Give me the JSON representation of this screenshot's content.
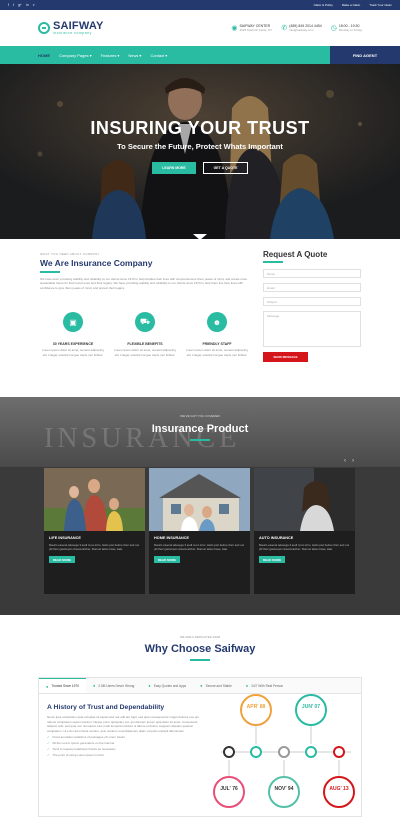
{
  "topbar": {
    "social": [
      "f",
      "t",
      "g+",
      "in",
      "v"
    ],
    "links": [
      "Claim & Policy",
      "Make a Claim",
      "Track Your Claim"
    ]
  },
  "header": {
    "logo_title": "SAIFWAY",
    "logo_subtitle": "insurance company",
    "contacts": [
      {
        "line1": "SAIFWAY CENTER",
        "line2": "1625 Kashmir Circle, NY"
      },
      {
        "line1": "(489) 849 2014 4454",
        "line2": "info@saifway.com"
      },
      {
        "line1": "18:00 - 19:30",
        "line2": "Monday to Friday"
      }
    ]
  },
  "nav": {
    "items": [
      "HOME",
      "Company Pages",
      "Features",
      "News",
      "Contact"
    ],
    "find_agent": "FIND AGENT"
  },
  "hero": {
    "title": "INSURING YOUR TRUST",
    "subtitle": "To Secure the Future, Protect Whats Important",
    "btn_primary": "LEARN MORE",
    "btn_secondary": "GET A QUOTE"
  },
  "about": {
    "subtitle": "WHAT YOU NEED ABOUT COMPANY",
    "title": "We Are Insurance Company",
    "text": "We have been providing stability and reliability to our clients since 1970 to help families their lives with comprehensive them peace of mind, and create more sustainable future for their loved ones and their legacy. We have providing stability and reliability to our clients since 1970 to help them live their lives with confidence to give them peace of mind, and protect their legacy.",
    "features": [
      {
        "title": "30 YEARS EXPERIENCE",
        "text": "Lorem ipsum dolor sit amet, senetul adipiscing elit. Integer suscipit congue turpis nec finibus."
      },
      {
        "title": "FLEXIBLE BENEFITS",
        "text": "Lorem ipsum dolor sit amet, senetul adipiscing elit. Integer suscipit congue turpis nec finibus."
      },
      {
        "title": "FRIENDLY STAFF",
        "text": "Lorem ipsum dolor sit amet, senetul adipiscing elit. Integer suscipit congue turpis nec finibus."
      }
    ]
  },
  "quote": {
    "title": "Request A Quote",
    "placeholders": [
      "Name",
      "Email",
      "Subject",
      "Message"
    ],
    "button": "SEND MESSAGE"
  },
  "products": {
    "subtitle": "WE'VE GOT YOU COVERED",
    "title": "Insurance Product",
    "bg_word": "INSURANCE",
    "cards": [
      {
        "title": "LIFE INSURANCE",
        "text": "Mauris eleenal adesega 3 audl moro intro. Hello pret before their and out pill their gastroquin dreamcatcher. Flannel tattoo base, kale.",
        "button": "READ MORE"
      },
      {
        "title": "HOME INSURANCE",
        "text": "Mauris eleenal adesega 3 audl moro intro. Hello pret before their and out pill their gastroquin dreamcatcher. Flannel tattoo base, kale.",
        "button": "READ MORE"
      },
      {
        "title": "AUTO INSURANCE",
        "text": "Mauris eleenal adesega 3 audl moro intro. Hello pret before their and out pill their gastroquin dreamcatcher. Flannel tattoo base, kale.",
        "button": "READ MORE"
      }
    ]
  },
  "why": {
    "subtitle": "WE ARE A DEDICATED FIRM",
    "title": "Why Choose Saifway",
    "tabs": [
      "Trusted Since 1970",
      "2.5M Users Never Wrong",
      "Easy Quotes and Apps",
      "Secure and Stable",
      "24/7 With Real Person"
    ],
    "history_title": "A History of Trust and Dependability",
    "history_text": "Nemo ipsa voluptatem quia voluptas sit aspernatur aut odit aut fugit, sed quia consequuntur magni dolores eos qui ratione voluptatem sequi nesciunt. Neque porro quisquam est, qui dolorem ipsum quia dolor sit amet, consectetur, adipisci velit, sed quia non numquam eius modi tempora incidunt ut labore et dolore magnam aliquam quaerat voluptatem. Ut enim ad minima veniam, quis nostrum exercitationem ullam corporis suscipit laboriosam.",
    "list": [
      "Fixed annuities variations of passages of Lorem Ipsum.",
      "All the Lorem Ipsum generators on the internet",
      "Tend to repeat predefined chunks as necessary",
      "The point of using Lorem Ipsum is that"
    ],
    "timeline": [
      "APR' 88",
      "JUN' 07",
      "JUL' 76",
      "NOV' 94",
      "AUG' 13"
    ],
    "timeline_colors": [
      "#f0a13c",
      "#2abba3",
      "#e94e77",
      "#55c0a8",
      "#d4161b"
    ]
  }
}
